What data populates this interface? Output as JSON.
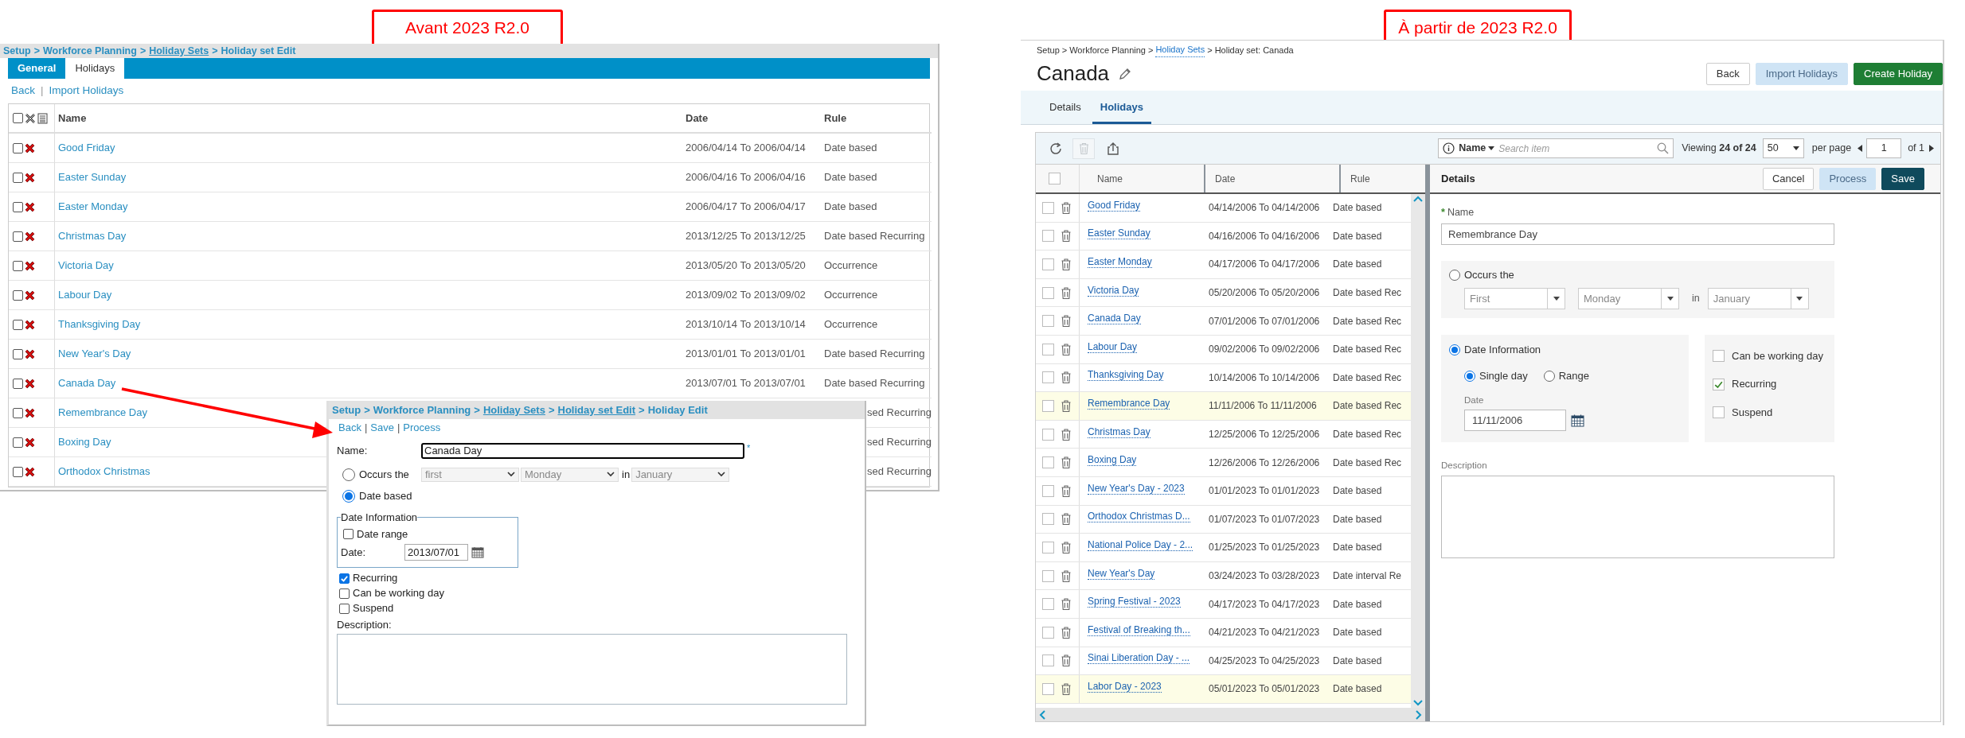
{
  "annotations": [
    {
      "text": "Avant 2023 R2.0"
    },
    {
      "text": "À partir de 2023 R2.0"
    }
  ],
  "old_ui": {
    "breadcrumb": {
      "separator": ">",
      "items": [
        {
          "text": "Setup",
          "link": false
        },
        {
          "text": "Workforce Planning",
          "link": false
        },
        {
          "text": "Holiday Sets",
          "link": true
        },
        {
          "text": "Holiday set Edit",
          "link": false
        }
      ]
    },
    "tabs": [
      {
        "label": "General",
        "selected": false
      },
      {
        "label": "Holidays",
        "selected": true
      }
    ],
    "actions": {
      "separator": "|",
      "items": [
        "Back",
        "Import Holidays"
      ]
    },
    "table": {
      "select_all_checked": false,
      "columns": [
        "Name",
        "Date",
        "Rule"
      ],
      "rows": [
        {
          "name": "Good Friday",
          "date": "2006/04/14 To 2006/04/14",
          "rule": "Date based",
          "checked": false
        },
        {
          "name": "Easter Sunday",
          "date": "2006/04/16 To 2006/04/16",
          "rule": "Date based",
          "checked": false
        },
        {
          "name": "Easter Monday",
          "date": "2006/04/17 To 2006/04/17",
          "rule": "Date based",
          "checked": false
        },
        {
          "name": "Christmas Day",
          "date": "2013/12/25 To 2013/12/25",
          "rule": "Date based Recurring",
          "checked": false
        },
        {
          "name": "Victoria Day",
          "date": "2013/05/20 To 2013/05/20",
          "rule": "Occurrence",
          "checked": false
        },
        {
          "name": "Labour Day",
          "date": "2013/09/02 To 2013/09/02",
          "rule": "Occurrence",
          "checked": false
        },
        {
          "name": "Thanksgiving Day",
          "date": "2013/10/14 To 2013/10/14",
          "rule": "Occurrence",
          "checked": false
        },
        {
          "name": "New Year's Day",
          "date": "2013/01/01 To 2013/01/01",
          "rule": "Date based Recurring",
          "checked": false
        },
        {
          "name": "Canada Day",
          "date": "2013/07/01 To 2013/07/01",
          "rule": "Date based Recurring",
          "checked": false
        },
        {
          "name": "Remembrance Day",
          "rule": "sed Recurring",
          "checked": false
        },
        {
          "name": "Boxing Day",
          "rule": "sed Recurring",
          "checked": false
        },
        {
          "name": "Orthodox Christmas",
          "rule": "sed Recurring",
          "checked": false
        }
      ]
    }
  },
  "old_edit_popup": {
    "breadcrumb": {
      "separator": ">",
      "items": [
        {
          "text": "Setup",
          "link": false
        },
        {
          "text": "Workforce Planning",
          "link": false
        },
        {
          "text": "Holiday Sets",
          "link": true
        },
        {
          "text": "Holiday set Edit",
          "link": true
        },
        {
          "text": "Holiday Edit",
          "link": false
        }
      ]
    },
    "actions": {
      "separator": "|",
      "items": [
        "Back",
        "Save",
        "Process"
      ]
    },
    "name_label": "Name:",
    "name_value": "Canada Day",
    "required_mark": "*",
    "occurs": {
      "label": "Occurs the",
      "selected": false,
      "selects": [
        "first",
        "Monday",
        "January"
      ],
      "in_label": "in"
    },
    "date_based": {
      "label": "Date based",
      "selected": true
    },
    "date_information": {
      "legend": "Date Information",
      "date_range": {
        "label": "Date range",
        "checked": false
      },
      "date_label": "Date:",
      "date_value": "2013/07/01"
    },
    "options": [
      {
        "label": "Recurring",
        "checked": true
      },
      {
        "label": "Can be working day",
        "checked": false
      },
      {
        "label": "Suspend",
        "checked": false
      }
    ],
    "description_label": "Description:"
  },
  "new_ui": {
    "breadcrumb": {
      "separator": ">",
      "items": [
        {
          "text": "Setup",
          "link": false
        },
        {
          "text": "Workforce Planning",
          "link": false
        },
        {
          "text": "Holiday Sets",
          "link": true
        },
        {
          "text": "Holiday set: Canada",
          "link": false
        }
      ]
    },
    "title": "Canada",
    "buttons": [
      {
        "label": "Back",
        "kind": "default"
      },
      {
        "label": "Import Holidays",
        "kind": "light"
      },
      {
        "label": "Create Holiday",
        "kind": "primary"
      }
    ],
    "tabs": [
      {
        "label": "Details",
        "selected": false
      },
      {
        "label": "Holidays",
        "selected": true
      }
    ],
    "search": {
      "field": "Name",
      "placeholder": "Search item"
    },
    "viewing": "Viewing **24 of 24**",
    "per_page": {
      "value": "50",
      "label": "per page"
    },
    "page": {
      "value": "1",
      "of_label": "of 1"
    },
    "grid": {
      "select_all_checked": false,
      "columns": [
        "Name",
        "Date",
        "Rule"
      ],
      "rows": [
        {
          "name": "Good Friday",
          "date": "04/14/2006 To 04/14/2006",
          "rule": "Date based",
          "selected": false,
          "checked": false
        },
        {
          "name": "Easter Sunday",
          "date": "04/16/2006 To 04/16/2006",
          "rule": "Date based",
          "selected": false,
          "checked": false
        },
        {
          "name": "Easter Monday",
          "date": "04/17/2006 To 04/17/2006",
          "rule": "Date based",
          "selected": false,
          "checked": false
        },
        {
          "name": "Victoria Day",
          "date": "05/20/2006 To 05/20/2006",
          "rule": "Date based Rec",
          "selected": false,
          "checked": false
        },
        {
          "name": "Canada Day",
          "date": "07/01/2006 To 07/01/2006",
          "rule": "Date based Rec",
          "selected": false,
          "checked": false
        },
        {
          "name": "Labour Day",
          "date": "09/02/2006 To 09/02/2006",
          "rule": "Date based Rec",
          "selected": false,
          "checked": false
        },
        {
          "name": "Thanksgiving Day",
          "date": "10/14/2006 To 10/14/2006",
          "rule": "Date based Rec",
          "selected": false,
          "checked": false
        },
        {
          "name": "Remembrance Day",
          "date": "11/11/2006 To 11/11/2006",
          "rule": "Date based Rec",
          "selected": true,
          "checked": false
        },
        {
          "name": "Christmas Day",
          "date": "12/25/2006 To 12/25/2006",
          "rule": "Date based Rec",
          "selected": false,
          "checked": false
        },
        {
          "name": "Boxing Day",
          "date": "12/26/2006 To 12/26/2006",
          "rule": "Date based Rec",
          "selected": false,
          "checked": false
        },
        {
          "name": "New Year's Day - 2023",
          "date": "01/01/2023 To 01/01/2023",
          "rule": "Date based",
          "selected": false,
          "checked": false
        },
        {
          "name": "Orthodox Christmas D...",
          "date": "01/07/2023 To 01/07/2023",
          "rule": "Date based",
          "selected": false,
          "checked": false
        },
        {
          "name": "National Police Day - 2...",
          "date": "01/25/2023 To 01/25/2023",
          "rule": "Date based",
          "selected": false,
          "checked": false
        },
        {
          "name": "New Year's Day",
          "date": "03/24/2023 To 03/28/2023",
          "rule": "Date interval Re",
          "selected": false,
          "checked": false
        },
        {
          "name": "Spring Festival - 2023",
          "date": "04/17/2023 To 04/17/2023",
          "rule": "Date based",
          "selected": false,
          "checked": false
        },
        {
          "name": "Festival of Breaking th...",
          "date": "04/21/2023 To 04/21/2023",
          "rule": "Date based",
          "selected": false,
          "checked": false
        },
        {
          "name": "Sinai Liberation Day - ...",
          "date": "04/25/2023 To 04/25/2023",
          "rule": "Date based",
          "selected": false,
          "checked": false
        },
        {
          "name": "Labor Day - 2023",
          "date": "05/01/2023 To 05/01/2023",
          "rule": "Date based",
          "selected": true,
          "checked": false
        }
      ]
    },
    "details": {
      "title": "Details",
      "buttons": [
        {
          "label": "Cancel",
          "kind": "default"
        },
        {
          "label": "Process",
          "kind": "light"
        },
        {
          "label": "Save",
          "kind": "dark"
        }
      ],
      "name_label": "Name",
      "required_mark": "*",
      "name_value": "Remembrance Day",
      "occurs": {
        "label": "Occurs the",
        "selected": false,
        "selects": [
          "First",
          "Monday",
          "January"
        ],
        "in_label": "in"
      },
      "date_information": {
        "label": "Date Information",
        "selected": true,
        "modes": [
          {
            "label": "Single day",
            "selected": true
          },
          {
            "label": "Range",
            "selected": false
          }
        ],
        "date_label": "Date",
        "date_value": "11/11/2006"
      },
      "options": [
        {
          "label": "Can be working day",
          "checked": false
        },
        {
          "label": "Recurring",
          "checked": true
        },
        {
          "label": "Suspend",
          "checked": false
        }
      ],
      "description_label": "Description"
    }
  }
}
